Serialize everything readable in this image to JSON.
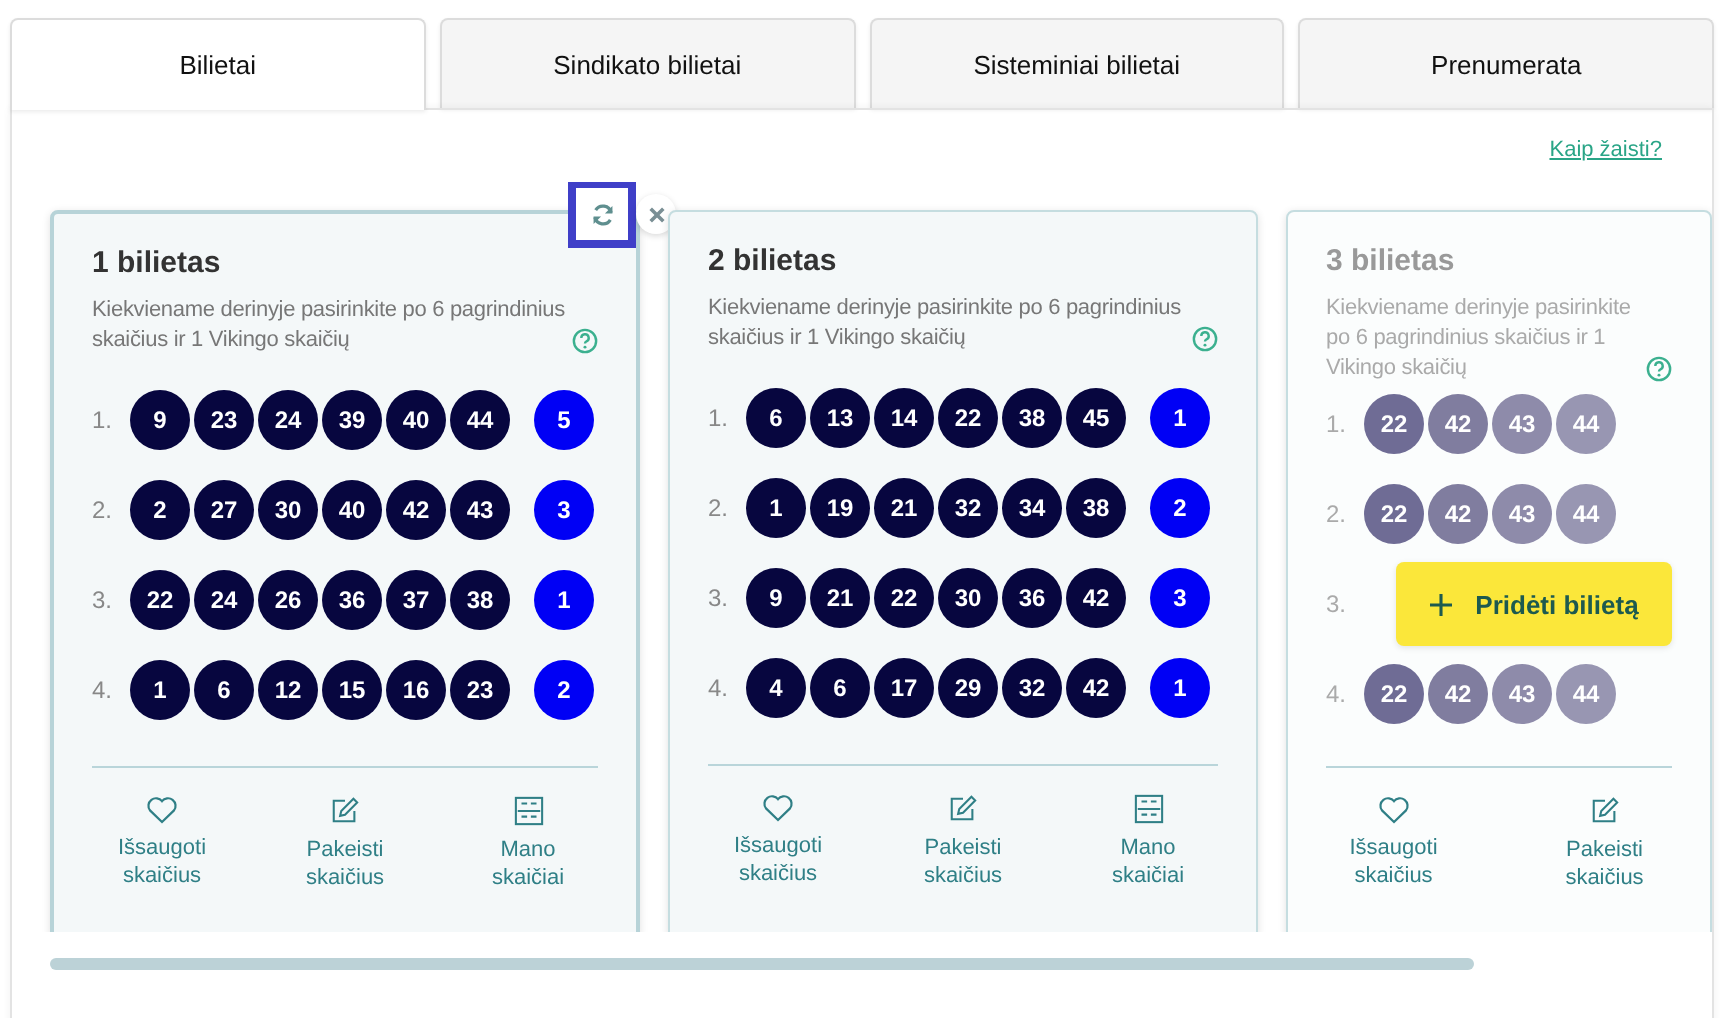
{
  "tabs": [
    {
      "label": "Bilietai",
      "selected": true
    },
    {
      "label": "Sindikato bilietai",
      "selected": false
    },
    {
      "label": "Sisteminiai bilietai",
      "selected": false
    },
    {
      "label": "Prenumerata",
      "selected": false
    }
  ],
  "help_link": "Kaip žaisti?",
  "tickets": [
    {
      "kind": "filled",
      "selected": true,
      "show_controls": true,
      "refresh_focused": true,
      "title": "1 bilietas",
      "description": "Kiekviename derinyje pasirinkite po 6 pagrindinius skaičius ir 1 Vikingo skaičių",
      "rows": [
        {
          "label": "1.",
          "numbers": [
            "9",
            "23",
            "24",
            "39",
            "40",
            "44"
          ],
          "bonus": "5"
        },
        {
          "label": "2.",
          "numbers": [
            "2",
            "27",
            "30",
            "40",
            "42",
            "43"
          ],
          "bonus": "3"
        },
        {
          "label": "3.",
          "numbers": [
            "22",
            "24",
            "26",
            "36",
            "37",
            "38"
          ],
          "bonus": "1"
        },
        {
          "label": "4.",
          "numbers": [
            "1",
            "6",
            "12",
            "15",
            "16",
            "23"
          ],
          "bonus": "2"
        }
      ],
      "actions": [
        {
          "kind": "saved",
          "label": "Išsaugoti skaičius"
        },
        {
          "kind": "edit",
          "label": "Pakeisti skaičius"
        },
        {
          "kind": "mine",
          "label": "Mano skaičiai"
        }
      ]
    },
    {
      "kind": "filled",
      "selected": false,
      "show_controls": false,
      "title": "2 bilietas",
      "description": "Kiekviename derinyje pasirinkite po 6 pagrindinius skaičius ir 1 Vikingo skaičių",
      "rows": [
        {
          "label": "1.",
          "numbers": [
            "6",
            "13",
            "14",
            "22",
            "38",
            "45"
          ],
          "bonus": "1"
        },
        {
          "label": "2.",
          "numbers": [
            "1",
            "19",
            "21",
            "32",
            "34",
            "38"
          ],
          "bonus": "2"
        },
        {
          "label": "3.",
          "numbers": [
            "9",
            "21",
            "22",
            "30",
            "36",
            "42"
          ],
          "bonus": "3"
        },
        {
          "label": "4.",
          "numbers": [
            "4",
            "6",
            "17",
            "29",
            "32",
            "42"
          ],
          "bonus": "1"
        }
      ],
      "actions": [
        {
          "kind": "saved",
          "label": "Išsaugoti skaičius"
        },
        {
          "kind": "edit",
          "label": "Pakeisti skaičius"
        },
        {
          "kind": "mine",
          "label": "Mano skaičiai"
        }
      ]
    },
    {
      "kind": "placeholder",
      "selected": false,
      "show_controls": false,
      "title": "3 bilietas",
      "description": "Kiekviename derinyje pasirinkite po 6 pagrindinius skaičius ir 1 Vikingo skaičių",
      "rows": [
        {
          "label": "1.",
          "numbers": [
            "22",
            "42",
            "43",
            "44"
          ]
        },
        {
          "label": "2.",
          "numbers": [
            "22",
            "42",
            "43",
            "44"
          ]
        },
        {
          "label": "3.",
          "numbers": []
        },
        {
          "label": "4.",
          "numbers": [
            "22",
            "42",
            "43",
            "44"
          ]
        }
      ],
      "actions": [
        {
          "kind": "saved",
          "label": "Išsaugoti skaičius"
        },
        {
          "kind": "edit",
          "label": "Pakeisti skaičius"
        }
      ]
    }
  ],
  "add_button": {
    "label": "Pridėti bilietą"
  }
}
